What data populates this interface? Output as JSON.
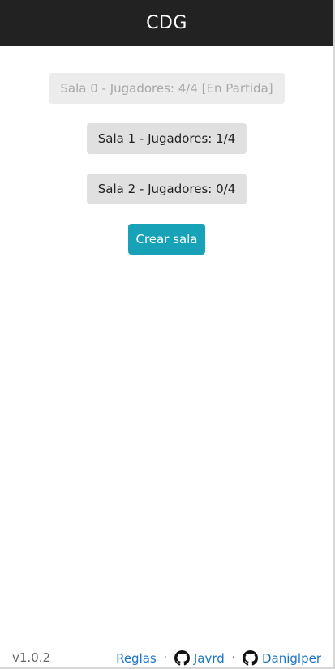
{
  "header": {
    "title": "CDG"
  },
  "rooms": [
    {
      "label": "Sala 0 - Jugadores: 4/4 [En Partida]",
      "disabled": true
    },
    {
      "label": "Sala 1 - Jugadores: 1/4",
      "disabled": false
    },
    {
      "label": "Sala 2 - Jugadores: 0/4",
      "disabled": false
    }
  ],
  "create_button": {
    "label": "Crear sala"
  },
  "footer": {
    "version": "v1.0.2",
    "links": [
      {
        "label": "Reglas",
        "icon": null
      },
      {
        "label": "Javrd",
        "icon": "github-icon"
      },
      {
        "label": "Daniglper",
        "icon": "github-icon"
      }
    ],
    "separator": "·"
  },
  "colors": {
    "header_bg": "#222222",
    "accent": "#17a2b8",
    "link": "#1a73c8"
  }
}
